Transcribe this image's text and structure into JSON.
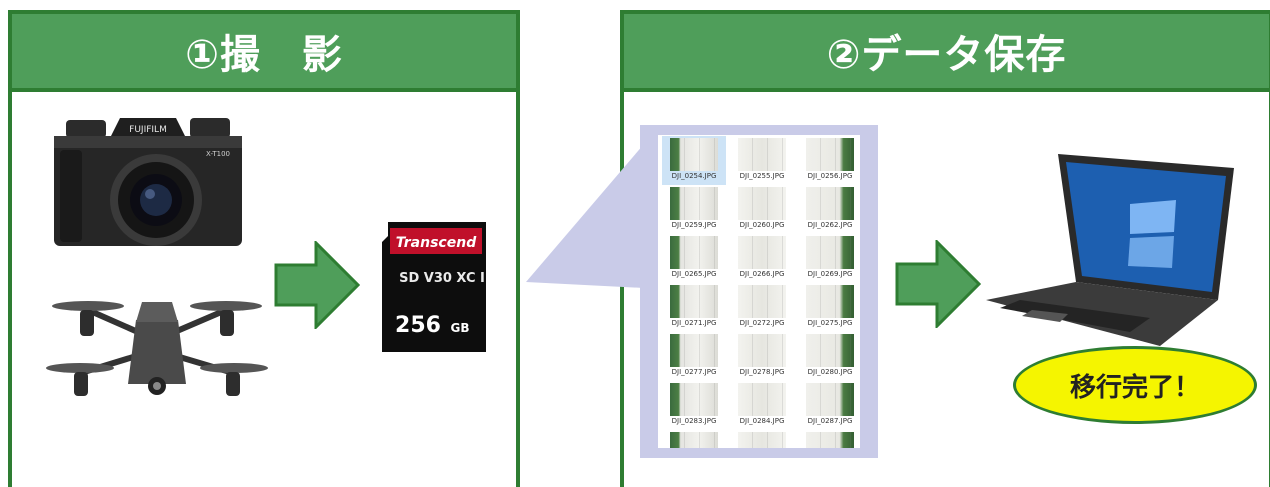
{
  "panels": {
    "shoot": {
      "title": "①撮　影"
    },
    "save": {
      "title": "②データ保存"
    }
  },
  "camera": {
    "brand": "FUJIFILM",
    "model": "X-T100"
  },
  "sd_card": {
    "brand": "Transcend",
    "capacity": "256",
    "unit": "GB",
    "marks": "SD V30 XC I"
  },
  "files": [
    "DJI_0254.JPG",
    "DJI_0255.JPG",
    "DJI_0256.JPG",
    "DJI_0259.JPG",
    "DJI_0260.JPG",
    "DJI_0262.JPG",
    "DJI_0265.JPG",
    "DJI_0266.JPG",
    "DJI_0269.JPG",
    "DJI_0271.JPG",
    "DJI_0272.JPG",
    "DJI_0275.JPG",
    "DJI_0277.JPG",
    "DJI_0278.JPG",
    "DJI_0280.JPG",
    "DJI_0283.JPG",
    "DJI_0284.JPG",
    "DJI_0287.JPG"
  ],
  "badge": {
    "text": "移行完了！"
  },
  "colors": {
    "header_green": "#4f9e5a",
    "border_green": "#2e7d32",
    "arrow_green": "#4f9e5a",
    "callout": "#c9cbe8",
    "badge_yellow": "#f5f500"
  }
}
